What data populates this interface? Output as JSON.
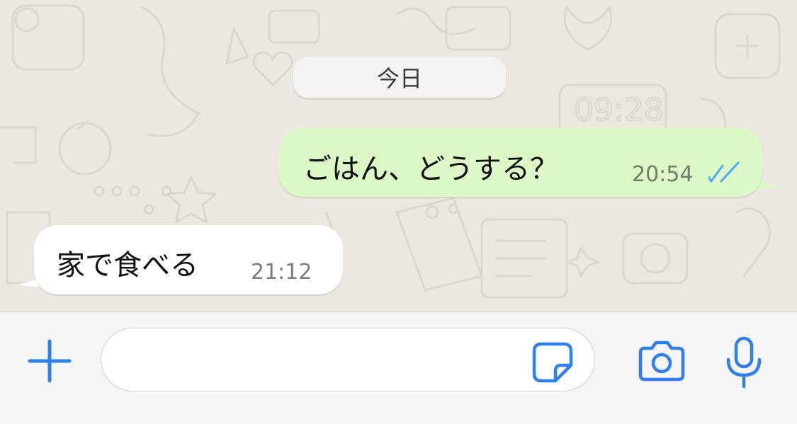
{
  "chat": {
    "date_separator": "今日",
    "messages": [
      {
        "direction": "outgoing",
        "text": "ごはん、どうする？",
        "time": "20:54",
        "status": "read"
      },
      {
        "direction": "incoming",
        "text": "家で食べる",
        "time": "21:12"
      }
    ]
  },
  "composer": {
    "message_value": "",
    "icons": {
      "plus": "plus-icon",
      "sticker": "sticker-icon",
      "camera": "camera-icon",
      "mic": "microphone-icon"
    }
  },
  "colors": {
    "accent": "#2f80ed",
    "outgoing_bubble": "#dcf8c6",
    "incoming_bubble": "#ffffff",
    "chat_background": "#ece7e0",
    "read_ticks": "#4fa8ff"
  }
}
